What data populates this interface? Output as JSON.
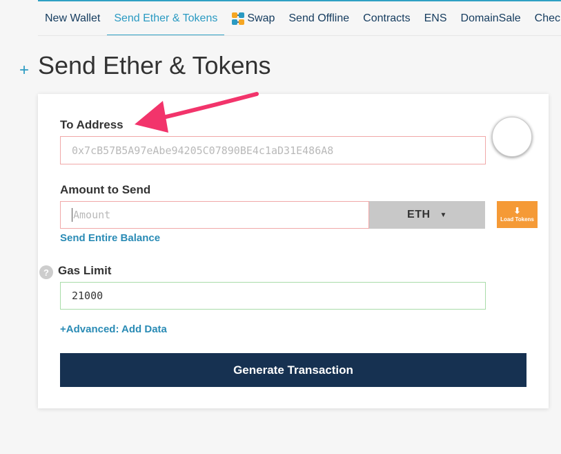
{
  "nav": {
    "items": [
      {
        "label": "New Wallet"
      },
      {
        "label": "Send Ether & Tokens"
      },
      {
        "label": "Swap"
      },
      {
        "label": "Send Offline"
      },
      {
        "label": "Contracts"
      },
      {
        "label": "ENS"
      },
      {
        "label": "DomainSale"
      },
      {
        "label": "Check T..."
      }
    ],
    "active_index": 1
  },
  "page": {
    "plus": "+",
    "title": "Send Ether & Tokens"
  },
  "form": {
    "to_address_label": "To Address",
    "to_address_placeholder": "0x7cB57B5A97eAbe94205C07890BE4c1aD31E486A8",
    "amount_label": "Amount to Send",
    "amount_placeholder": "Amount",
    "unit": "ETH",
    "load_tokens": "Load Tokens",
    "send_entire_balance": "Send Entire Balance",
    "gas_limit_label": "Gas Limit",
    "gas_limit_value": "21000",
    "help": "?",
    "advanced": "+Advanced: Add Data",
    "generate": "Generate Transaction"
  },
  "colors": {
    "accent": "#2ea0c4",
    "primary_button": "#163151",
    "load_tokens": "#f59a36",
    "annotation_arrow": "#f2346b"
  }
}
